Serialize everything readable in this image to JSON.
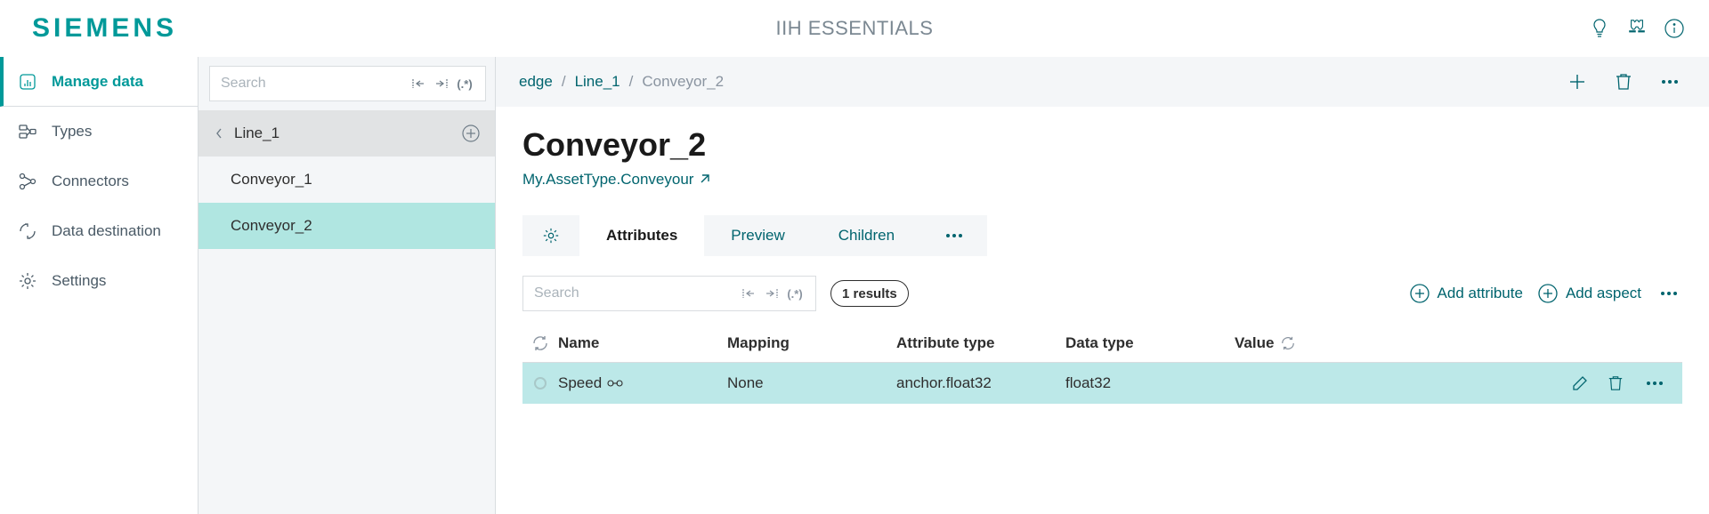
{
  "header": {
    "logo": "SIEMENS",
    "app_title": "IIH ESSENTIALS"
  },
  "sidebar": {
    "items": [
      {
        "label": "Manage data"
      },
      {
        "label": "Types"
      },
      {
        "label": "Connectors"
      },
      {
        "label": "Data destination"
      },
      {
        "label": "Settings"
      }
    ]
  },
  "tree": {
    "search_placeholder": "Search",
    "parent": "Line_1",
    "children": [
      {
        "label": "Conveyor_1"
      },
      {
        "label": "Conveyor_2"
      }
    ]
  },
  "breadcrumbs": {
    "root": "edge",
    "level1": "Line_1",
    "current": "Conveyor_2"
  },
  "main": {
    "title": "Conveyor_2",
    "subtype": "My.AssetType.Conveyour",
    "tabs": {
      "attributes": "Attributes",
      "preview": "Preview",
      "children": "Children"
    },
    "attr_search_placeholder": "Search",
    "results_label": "1 results",
    "add_attribute": "Add attribute",
    "add_aspect": "Add aspect",
    "columns": {
      "name": "Name",
      "mapping": "Mapping",
      "attr_type": "Attribute type",
      "data_type": "Data type",
      "value": "Value"
    },
    "row": {
      "name": "Speed",
      "mapping": "None",
      "attr_type": "anchor.float32",
      "data_type": "float32",
      "value": ""
    }
  }
}
